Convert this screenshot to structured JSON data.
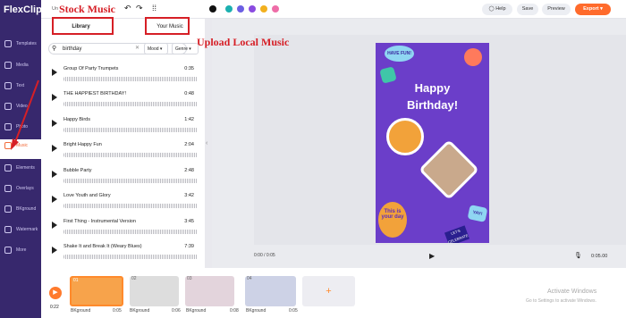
{
  "app": {
    "logo": "FlexClip",
    "title": "Un"
  },
  "sidebar": {
    "items": [
      {
        "label": "Templates"
      },
      {
        "label": "Media"
      },
      {
        "label": "Text"
      },
      {
        "label": "Video"
      },
      {
        "label": "Photo"
      },
      {
        "label": "Music"
      },
      {
        "label": "Elements"
      },
      {
        "label": "Overlays"
      },
      {
        "label": "BKground"
      },
      {
        "label": "Watermark"
      },
      {
        "label": "More"
      }
    ]
  },
  "topbar": {
    "help": "Help",
    "save": "Save",
    "preview": "Preview",
    "export": "Export"
  },
  "colors": [
    "#111111",
    "#1bb0b0",
    "#6b5fe3",
    "#8a4be0",
    "#f2b01e",
    "#ee6da8"
  ],
  "music": {
    "tab_library": "Library",
    "tab_your_music": "Your Music",
    "search_value": "birthday",
    "mood": "Mood",
    "genre": "Genre",
    "tracks": [
      {
        "title": "Group Of Party Trumpets",
        "duration": "0:35"
      },
      {
        "title": "THE HAPPIEST BIRTHDAY!",
        "duration": "0:48"
      },
      {
        "title": "Happy Birds",
        "duration": "1:42"
      },
      {
        "title": "Bright Happy Fun",
        "duration": "2:04"
      },
      {
        "title": "Bubble Party",
        "duration": "2:48"
      },
      {
        "title": "Love Youth and Glory",
        "duration": "3:42"
      },
      {
        "title": "First Thing - Instrumental Version",
        "duration": "3:45"
      },
      {
        "title": "Shake It and Break It (Weary Blues)",
        "duration": "7:39"
      }
    ]
  },
  "card": {
    "badge1": "HAVE FUN!",
    "line1": "Happy",
    "line2": "Birthday!",
    "badge2": "This is your day",
    "badge3": "YAY!",
    "badge4": "LET'S CELEBRATE"
  },
  "player": {
    "time": "0:00 / 0:05",
    "total": "0:05.00"
  },
  "timeline": {
    "current": "0:22",
    "clips": [
      {
        "num": "01",
        "label": "BKground",
        "dur": "0:05"
      },
      {
        "num": "02",
        "label": "BKground",
        "dur": "0:06"
      },
      {
        "num": "03",
        "label": "BKground",
        "dur": "0:08"
      },
      {
        "num": "04",
        "label": "BKground",
        "dur": "0:05"
      }
    ],
    "add": "+"
  },
  "annotations": {
    "stock": "Stock Music",
    "upload": "Upload Local Music"
  },
  "watermark": {
    "line1": "Activate Windows",
    "line2": "Go to Settings to activate Windows."
  }
}
